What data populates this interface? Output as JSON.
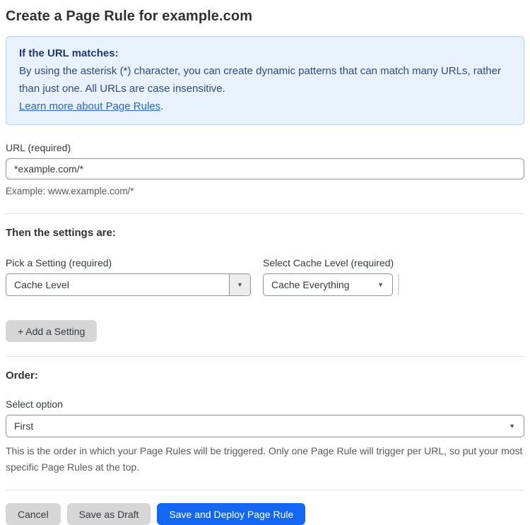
{
  "page": {
    "title": "Create a Page Rule for example.com"
  },
  "info_box": {
    "heading": "If the URL matches:",
    "body": "By using the asterisk (*) character, you can create dynamic patterns that can match many URLs, rather than just one. All URLs are case insensitive.",
    "link": "Learn more about Page Rules",
    "link_suffix": "."
  },
  "url_field": {
    "label": "URL (required)",
    "value": "*example.com/*",
    "hint": "Example: www.example.com/*"
  },
  "settings": {
    "heading": "Then the settings are:",
    "setting_label": "Pick a Setting (required)",
    "setting_value": "Cache Level",
    "cache_label": "Select Cache Level (required)",
    "cache_value": "Cache Everything",
    "dropdown_arrow": "▼",
    "add_button": "+ Add a Setting"
  },
  "order": {
    "heading": "Order:",
    "label": "Select option",
    "value": "First",
    "dropdown_arrow": "▼",
    "hint": "This is the order in which your Page Rules will be triggered. Only one Page Rule will trigger per URL, so put your most specific Page Rules at the top."
  },
  "actions": {
    "cancel": "Cancel",
    "save_draft": "Save as Draft",
    "save_deploy": "Save and Deploy Page Rule"
  },
  "colors": {
    "accent_blue": "#1467f2",
    "info_bg": "#e9f2fc",
    "info_border": "#b4d3ef",
    "info_heading_text": "#1e3a6e",
    "info_body_text": "#2d4a80",
    "link_blue": "#2c63c9",
    "button_gray": "#d6d6d6",
    "text_dark": "#36393f",
    "hint_gray": "#595959"
  }
}
